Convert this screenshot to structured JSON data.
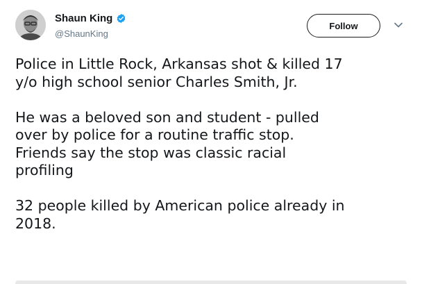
{
  "author": {
    "display_name": "Shaun King",
    "handle": "@ShaunKing",
    "verified_icon": "verified-badge-icon",
    "avatar_icon": "avatar"
  },
  "actions": {
    "follow_label": "Follow",
    "more_icon": "chevron-down-icon"
  },
  "tweet": {
    "paragraphs": [
      "Police in Little Rock, Arkansas shot & killed 17\ny/o high school senior Charles Smith, Jr.",
      "He was a beloved son and student - pulled\nover by police for a routine traffic stop.\nFriends say the stop was classic racial\nprofiling",
      "32 people killed by American police already in\n2018."
    ]
  },
  "colors": {
    "text": "#14171a",
    "secondary_text": "#657786",
    "verified_blue": "#1da1f2",
    "border": "#1a1a1a"
  }
}
